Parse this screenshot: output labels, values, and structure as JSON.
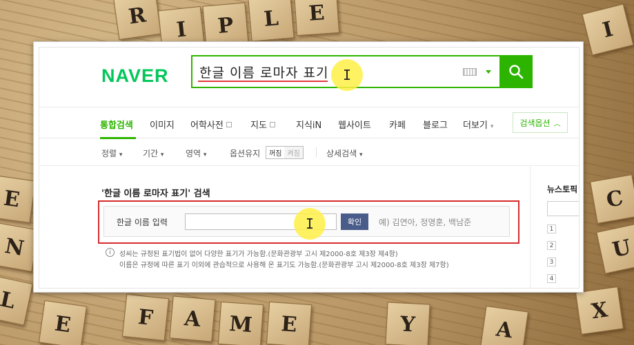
{
  "background": {
    "tiles": [
      "R",
      "I",
      "P",
      "L",
      "E",
      "E",
      "N",
      "C",
      "U",
      "F",
      "A",
      "M",
      "E",
      "A",
      "I",
      "X",
      "L",
      "E",
      "Y"
    ]
  },
  "header": {
    "logo": "NAVER",
    "search_query": "한글 이름 로마자 표기",
    "search_icon": "magnifier-icon",
    "keyboard_icon": "keyboard-icon",
    "brand_color": "#2db400"
  },
  "nav": {
    "items": [
      "통합검색",
      "이미지",
      "어학사전",
      "지도",
      "지식iN",
      "웹사이트",
      "카페",
      "블로그",
      "더보기"
    ],
    "active_index": 0,
    "search_options": "검색옵션"
  },
  "subnav": {
    "items": [
      "정렬",
      "기간",
      "영역",
      "옵션유지",
      "상세검색"
    ],
    "toggle_on": "꺼짐",
    "toggle_off": "켜짐"
  },
  "content": {
    "title": "'한글 이름 로마자 표기' 검색",
    "input_label": "한글 이름 입력",
    "confirm_button": "확인",
    "example": "예) 김연아, 정명훈, 백남준",
    "notes": [
      "성씨는 규정된 표기법이 없어 다양한 표기가 가능함.(문화관광부 고시 제2000-8호 제3장 제4항)",
      "이름은 규정에 따른 표기 이외에 관습적으로 사용해 온 표기도 가능함.(문화관광부 고시 제2000-8호 제3장 제7항)"
    ],
    "info_icon": "i"
  },
  "right_column": {
    "title": "뉴스토픽",
    "numbers": [
      "1",
      "2",
      "3",
      "4"
    ]
  },
  "cursor_symbol": "I"
}
